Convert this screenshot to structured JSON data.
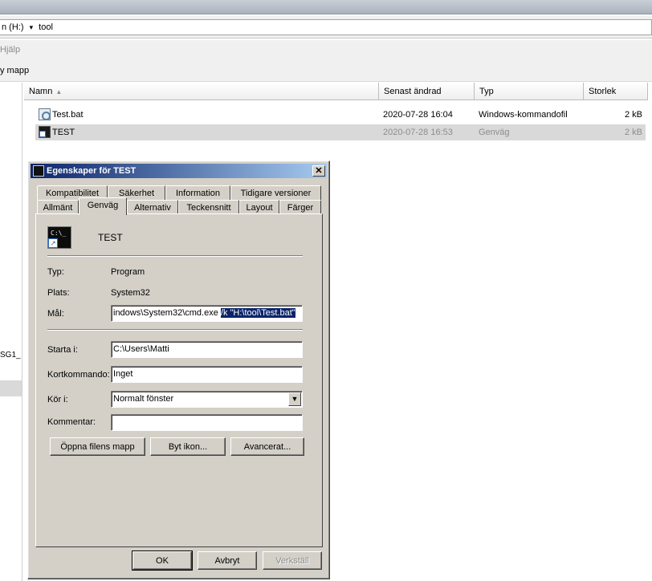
{
  "explorer": {
    "address": {
      "drive": "n (H:)",
      "chevron": "▾",
      "folder": "tool"
    },
    "menu": {
      "help": "Hjälp"
    },
    "toolbar": {
      "new_folder": "y mapp"
    },
    "navpane": {
      "partial_item": "SG1_"
    },
    "columns": [
      {
        "label": "Namn",
        "sort": "▲"
      },
      {
        "label": "Senast ändrad"
      },
      {
        "label": "Typ"
      },
      {
        "label": "Storlek"
      }
    ],
    "files": [
      {
        "name": "Test.bat",
        "modified": "2020-07-28 16:04",
        "type": "Windows-kommandofil",
        "size": "2 kB",
        "icon": "batch-file-icon",
        "selected": false
      },
      {
        "name": "TEST",
        "modified": "2020-07-28 16:53",
        "type": "Genväg",
        "size": "2 kB",
        "icon": "shortcut-icon",
        "selected": true
      }
    ]
  },
  "dialog": {
    "title": "Egenskaper för TEST",
    "close": "✕",
    "tabs_top": [
      "Kompatibilitet",
      "Säkerhet",
      "Information",
      "Tidigare versioner"
    ],
    "tabs_bottom": [
      "Allmänt",
      "Genväg",
      "Alternativ",
      "Teckensnitt",
      "Layout",
      "Färger"
    ],
    "active_tab": "Genväg",
    "icon_text": "C:\\_",
    "shortcut_name": "TEST",
    "fields": {
      "type_label": "Typ:",
      "type_value": "Program",
      "location_label": "Plats:",
      "location_value": "System32",
      "target_label": "Mål:",
      "target_value_plain": "indows\\System32\\cmd.exe ",
      "target_value_selected": "/k \"H:\\tool\\Test.bat\"",
      "start_label": "Starta i:",
      "start_value": "C:\\Users\\Matti",
      "hotkey_label": "Kortkommando:",
      "hotkey_value": "Inget",
      "run_label": "Kör i:",
      "run_value": "Normalt fönster",
      "comment_label": "Kommentar:",
      "comment_value": ""
    },
    "buttons": {
      "open_location": "Öppna filens mapp",
      "change_icon": "Byt ikon...",
      "advanced": "Avancerat...",
      "ok": "OK",
      "cancel": "Avbryt",
      "apply": "Verkställ"
    }
  }
}
